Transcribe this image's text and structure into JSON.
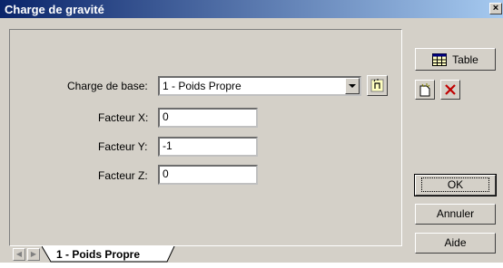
{
  "window": {
    "title": "Charge de gravité",
    "close_label": "×"
  },
  "form": {
    "base_label": "Charge de base:",
    "base_value": "1 - Poids Propre",
    "factor_x_label": "Facteur X:",
    "factor_x_value": "0",
    "factor_y_label": "Facteur Y:",
    "factor_y_value": "-1",
    "factor_z_label": "Facteur Z:",
    "factor_z_value": "0"
  },
  "side": {
    "table_label": "Table",
    "ok_label": "OK",
    "cancel_label": "Annuler",
    "help_label": "Aide"
  },
  "tabs": [
    {
      "label": "1 - Poids Propre"
    }
  ],
  "icons": [
    "pick-icon",
    "table-icon",
    "new-icon",
    "delete-icon",
    "tab-prev-icon",
    "tab-next-icon"
  ],
  "colors": {
    "title_start": "#0a246a",
    "title_end": "#a6caf0",
    "delete": "#c00000",
    "face": "#d4d0c8"
  }
}
